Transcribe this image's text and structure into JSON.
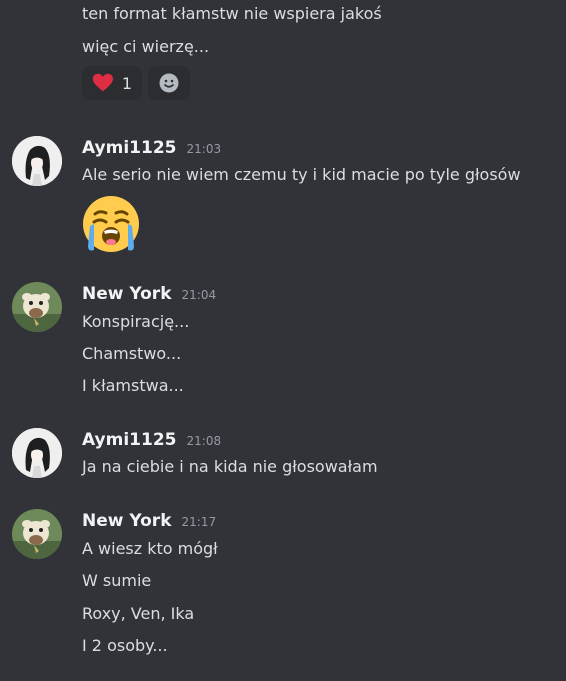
{
  "messages": [
    {
      "lines": [
        "ten format kłamstw nie wspiera jakoś",
        "więc ci wierzę..."
      ],
      "reactions": [
        {
          "emoji": "heart-emoji",
          "count": "1"
        },
        {
          "emoji": "add-reaction-icon"
        }
      ]
    },
    {
      "author": "Aymi1125",
      "time": "21:03",
      "lines": [
        "Ale serio nie wiem czemu ty i kid macie po tyle głosów"
      ],
      "emoji": "loudly-crying-face-emoji"
    },
    {
      "author": "New York",
      "time": "21:04",
      "lines": [
        "Konspirację...",
        "Chamstwo...",
        "I kłamstwa..."
      ]
    },
    {
      "author": "Aymi1125",
      "time": "21:08",
      "lines": [
        "Ja na ciebie i na kida nie głosowałam"
      ]
    },
    {
      "author": "New York",
      "time": "21:17",
      "lines": [
        "A wiesz kto mógł",
        "W sumie",
        "Roxy, Ven, Ika",
        "I 2 osoby..."
      ]
    }
  ],
  "colors": {
    "background": "#313338",
    "text": "#dbdee1",
    "username": "#f2f3f5",
    "timestamp": "#949ba4",
    "reaction_bg": "#2b2d31"
  }
}
